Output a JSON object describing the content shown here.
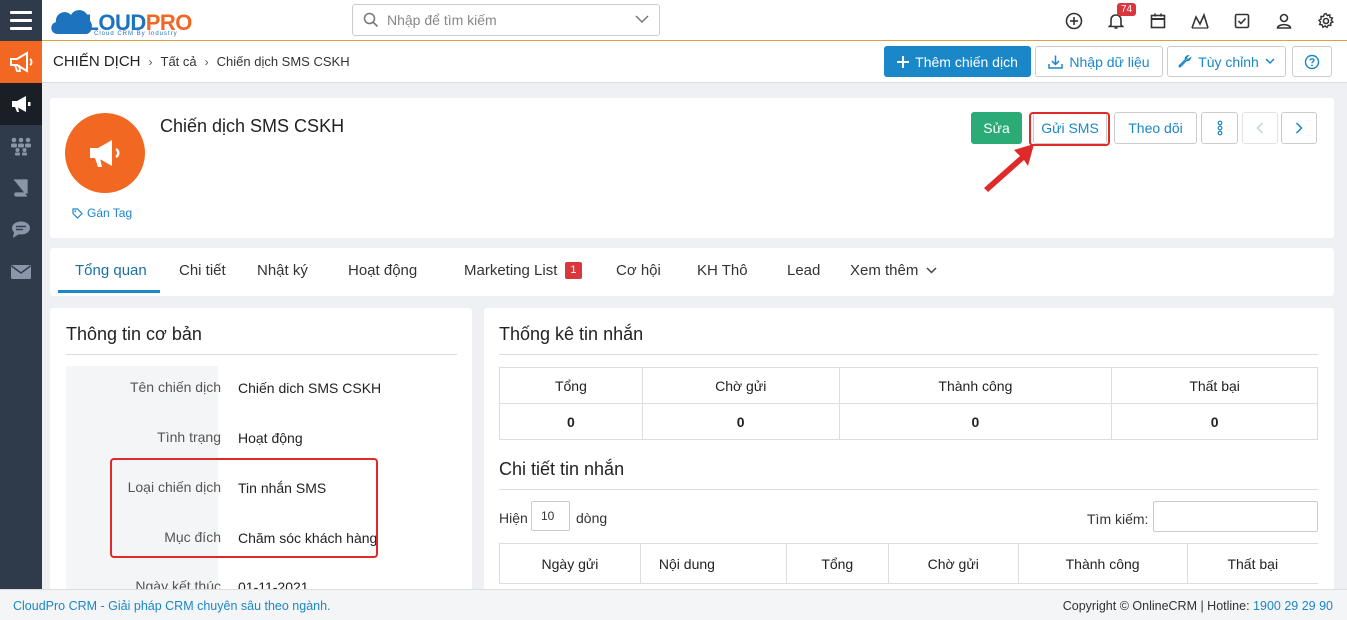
{
  "app": {
    "logo_cloud": "CLOUD",
    "logo_pro": "PRO",
    "logo_sub": "Cloud CRM By Industry"
  },
  "search": {
    "placeholder": "Nhập để tìm kiếm"
  },
  "notifications": {
    "count": "74"
  },
  "breadcrumb": {
    "root": "CHIẾN DỊCH",
    "level1": "Tất cả",
    "current": "Chiến dịch SMS CSKH"
  },
  "header_buttons": {
    "add": "Thêm chiến dịch",
    "import": "Nhập dữ liệu",
    "customize": "Tùy chỉnh"
  },
  "record": {
    "title": "Chiến dịch SMS CSKH",
    "tag": "Gán Tag",
    "edit": "Sửa",
    "send_sms": "Gửi SMS",
    "follow": "Theo dõi"
  },
  "tabs": [
    {
      "label": "Tổng quan"
    },
    {
      "label": "Chi tiết"
    },
    {
      "label": "Nhật ký"
    },
    {
      "label": "Hoạt động"
    },
    {
      "label": "Marketing List",
      "badge": "1"
    },
    {
      "label": "Cơ hội"
    },
    {
      "label": "KH Thô"
    },
    {
      "label": "Lead"
    },
    {
      "label": "Xem thêm"
    }
  ],
  "basic_info": {
    "title": "Thông tin cơ bản",
    "fields": [
      {
        "label": "Tên chiến dịch",
        "value": "Chiến dich SMS CSKH"
      },
      {
        "label": "Tình trạng",
        "value": "Hoạt động"
      },
      {
        "label": "Loại chiến dịch",
        "value": "Tin nhắn SMS"
      },
      {
        "label": "Mục đích",
        "value": "Chăm sóc khách hàng"
      },
      {
        "label": "Ngày kết thúc",
        "value": "01-11-2021"
      }
    ]
  },
  "stats": {
    "title": "Thống kê tin nhắn",
    "headers": [
      "Tổng",
      "Chờ gửi",
      "Thành công",
      "Thất bại"
    ],
    "values": [
      "0",
      "0",
      "0",
      "0"
    ]
  },
  "detail": {
    "title": "Chi tiết tin nhắn",
    "show_label": "Hiện",
    "rows_value": "10",
    "rows_label": "dòng",
    "search_label": "Tìm kiếm:",
    "headers": [
      "Ngày gửi",
      "Nội dung",
      "Tổng",
      "Chờ gửi",
      "Thành công",
      "Thất bại"
    ]
  },
  "footer": {
    "left": "CloudPro CRM - Giải pháp CRM chuyên sâu theo ngành.",
    "right": "Copyright © OnlineCRM | Hotline: ",
    "hotline": "1900 29 29 90"
  },
  "colors": {
    "brand_blue": "#1a87c9",
    "brand_orange": "#f26722",
    "success_green": "#2bab75",
    "annotation_red": "#e02a2a"
  }
}
